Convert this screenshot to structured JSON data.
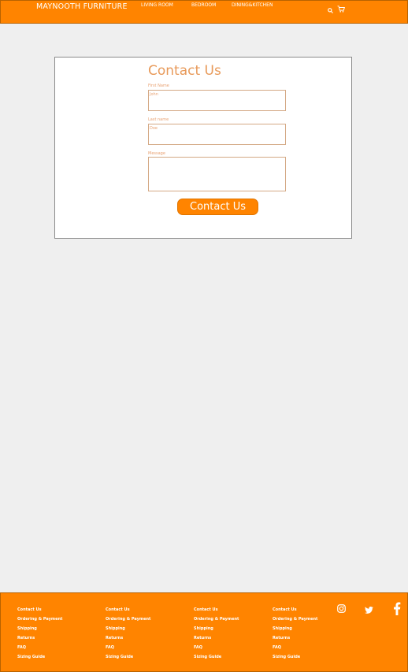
{
  "header": {
    "brand": "MAYNOOTH FURNITURE",
    "nav": [
      "LIVING ROOM",
      "BEDROOM",
      "DINING&KITCHEN"
    ],
    "icons": [
      "search-icon",
      "cart-icon"
    ]
  },
  "contact_form": {
    "title": "Contact Us",
    "first_name_label": "First Name",
    "first_name_value": "John",
    "last_name_label": "Last name",
    "last_name_value": "Doe",
    "message_label": "Message",
    "message_value": "",
    "submit_label": "Contact Us"
  },
  "footer": {
    "columns": [
      [
        "Contact Us",
        "Ordering & Payment",
        "Shipping",
        "Returns",
        "FAQ",
        "Sizing Guide"
      ],
      [
        "Contact Us",
        "Ordering & Payment",
        "Shipping",
        "Returns",
        "FAQ",
        "Sizing Guide"
      ],
      [
        "Contact Us",
        "Ordering & Payment",
        "Shipping",
        "Returns",
        "FAQ",
        "Sizing Guide"
      ],
      [
        "Contact Us",
        "Ordering & Payment",
        "Shipping",
        "Returns",
        "FAQ",
        "Sizing Guide"
      ]
    ],
    "social": [
      "instagram-icon",
      "twitter-icon",
      "facebook-icon"
    ]
  },
  "colors": {
    "accent": "#ff8400",
    "background": "#efefef",
    "label_text": "#e8a070"
  }
}
